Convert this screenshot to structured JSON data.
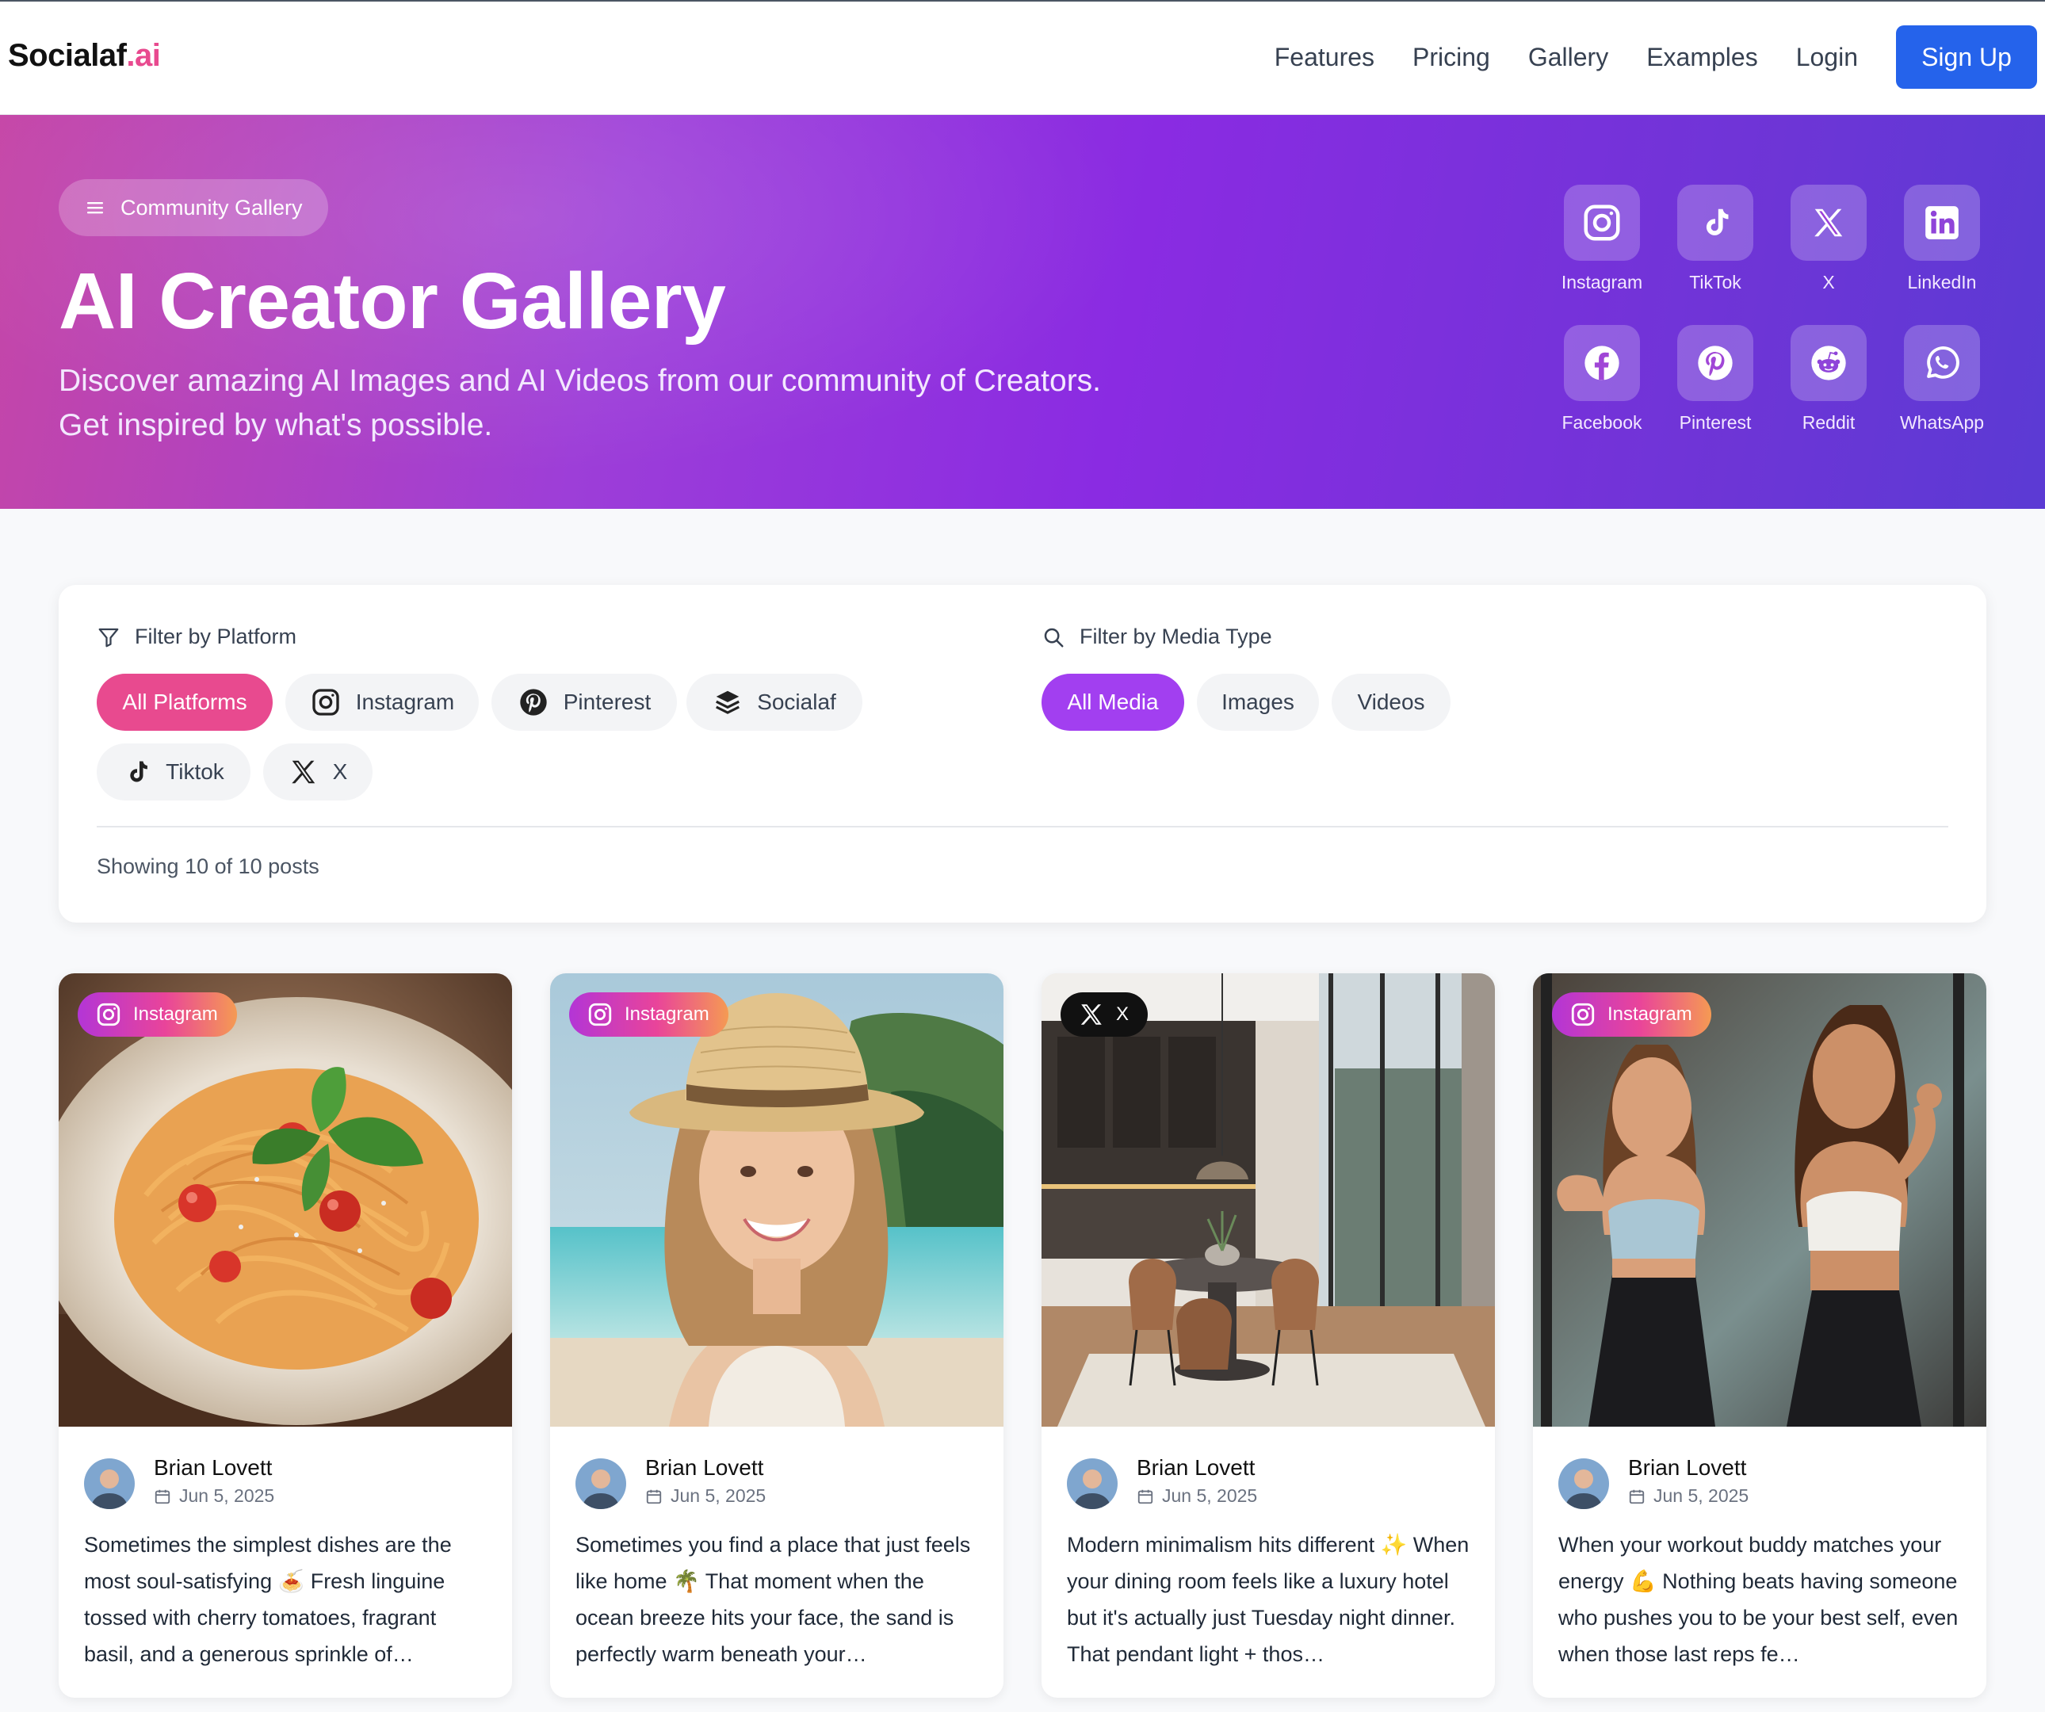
{
  "nav": {
    "logo_main": "Socialaf",
    "logo_ai": ".ai",
    "links": [
      "Features",
      "Pricing",
      "Gallery",
      "Examples",
      "Login"
    ],
    "signup": "Sign Up",
    "signup_color": "#2563eb"
  },
  "hero": {
    "chip": "Community Gallery",
    "title": "AI Creator Gallery",
    "subtitle": "Discover amazing AI Images and AI Videos from our community of Creators. Get inspired by what's possible.",
    "socials": [
      {
        "label": "Instagram",
        "icon": "instagram-icon"
      },
      {
        "label": "TikTok",
        "icon": "tiktok-icon"
      },
      {
        "label": "X",
        "icon": "x-icon"
      },
      {
        "label": "LinkedIn",
        "icon": "linkedin-icon"
      },
      {
        "label": "Facebook",
        "icon": "facebook-icon"
      },
      {
        "label": "Pinterest",
        "icon": "pinterest-icon"
      },
      {
        "label": "Reddit",
        "icon": "reddit-icon"
      },
      {
        "label": "WhatsApp",
        "icon": "whatsapp-icon"
      }
    ]
  },
  "filters": {
    "platform_title": "Filter by Platform",
    "platforms": [
      {
        "label": "All Platforms",
        "active": true
      },
      {
        "label": "Instagram",
        "icon": "instagram-icon"
      },
      {
        "label": "Pinterest",
        "icon": "pinterest-icon"
      },
      {
        "label": "Socialaf",
        "icon": "layers-icon"
      },
      {
        "label": "Tiktok",
        "icon": "tiktok-icon"
      },
      {
        "label": "X",
        "icon": "x-icon"
      }
    ],
    "media_title": "Filter by Media Type",
    "media": [
      {
        "label": "All Media",
        "active": true
      },
      {
        "label": "Images"
      },
      {
        "label": "Videos"
      }
    ],
    "showing": "Showing 10 of 10 posts",
    "active_pink": "#e84a8f",
    "active_purple": "#a23ff0"
  },
  "posts": [
    {
      "platform": "Instagram",
      "author": "Brian Lovett",
      "date": "Jun 5, 2025",
      "caption": "Sometimes the simplest dishes are the most soul-satisfying 🍝 Fresh linguine tossed with cherry tomatoes, fragrant basil, and a generous sprinkle of…"
    },
    {
      "platform": "Instagram",
      "author": "Brian Lovett",
      "date": "Jun 5, 2025",
      "caption": "Sometimes you find a place that just feels like home 🌴 That moment when the ocean breeze hits your face, the sand is perfectly warm beneath your…"
    },
    {
      "platform": "X",
      "author": "Brian Lovett",
      "date": "Jun 5, 2025",
      "caption": "Modern minimalism hits different ✨ When your dining room feels like a luxury hotel but it's actually just Tuesday night dinner. That pendant light + thos…"
    },
    {
      "platform": "Instagram",
      "author": "Brian Lovett",
      "date": "Jun 5, 2025",
      "caption": "When your workout buddy matches your energy 💪 Nothing beats having someone who pushes you to be your best self, even when those last reps fe…"
    }
  ]
}
